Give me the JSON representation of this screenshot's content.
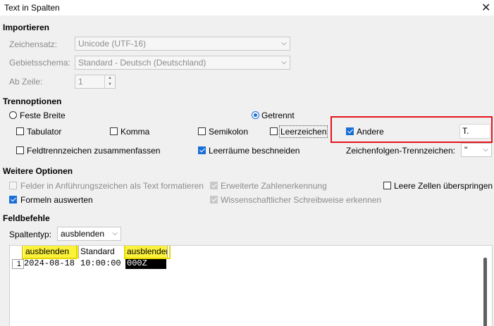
{
  "window": {
    "title": "Text in Spalten",
    "close_icon": "close-icon"
  },
  "import": {
    "heading": "Importieren",
    "charset_label": "Zeichensatz:",
    "charset_value": "Unicode (UTF-16)",
    "locale_label": "Gebietsschema:",
    "locale_value": "Standard - Deutsch (Deutschland)",
    "from_row_label": "Ab Zeile:",
    "from_row_value": "1"
  },
  "separator": {
    "heading": "Trennoptionen",
    "fixed_width": "Feste Breite",
    "separated": "Getrennt",
    "tab": "Tabulator",
    "comma": "Komma",
    "semicolon": "Semikolon",
    "space": "Leerzeichen",
    "other": "Andere",
    "other_value": "T.",
    "merge": "Feldtrennzeichen zusammenfassen",
    "trim": "Leerräume beschneiden",
    "string_delim_label": "Zeichenfolgen-Trennzeichen:",
    "string_delim_value": "\""
  },
  "other_options": {
    "heading": "Weitere Optionen",
    "quoted_as_text": "Felder in Anführungszeichen als Text formatieren",
    "detect_special": "Erweiterte Zahlenerkennung",
    "skip_empty": "Leere Zellen überspringen",
    "evaluate_formulas": "Formeln auswerten",
    "scientific": "Wissenschaftlicher Schreibweise erkennen"
  },
  "fields": {
    "heading": "Feldbefehle",
    "column_type_label": "Spaltentyp:",
    "column_type_value": "ausblenden",
    "columns": [
      "ausblenden",
      "Standard",
      "ausblenden"
    ],
    "rows": [
      {
        "num": "1",
        "cells": [
          "2024-08-18",
          "10:00:00",
          "000Z"
        ]
      }
    ]
  }
}
